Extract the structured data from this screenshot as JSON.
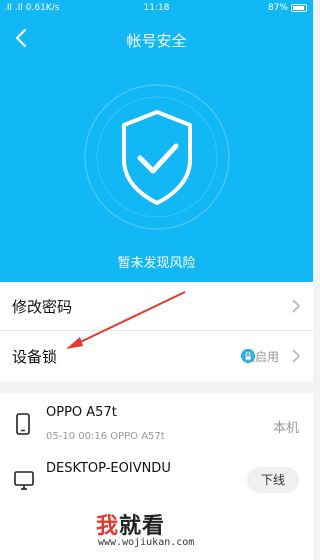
{
  "statusbar": {
    "left": ".Il .Il 0.61K/s",
    "time": "11:18",
    "right": "87%"
  },
  "header": {
    "title": "帐号安全"
  },
  "hero": {
    "status": "暂未发现风险"
  },
  "menu": {
    "change_password": "修改密码",
    "device_lock": "设备锁",
    "device_lock_status": "已启用"
  },
  "devices": [
    {
      "name": "OPPO A57t",
      "detail": "05-10 00:16 OPPO A57t",
      "tag": "本机",
      "icon": "phone-icon"
    },
    {
      "name": "DESKTOP-EOIVNDU",
      "action": "下线",
      "icon": "monitor-icon"
    }
  ],
  "watermark": {
    "char1": "我",
    "rest": "就看",
    "url": "www.wojiukan.com"
  },
  "colors": {
    "accent": "#12b7f5",
    "arrow": "#e23a2f"
  }
}
